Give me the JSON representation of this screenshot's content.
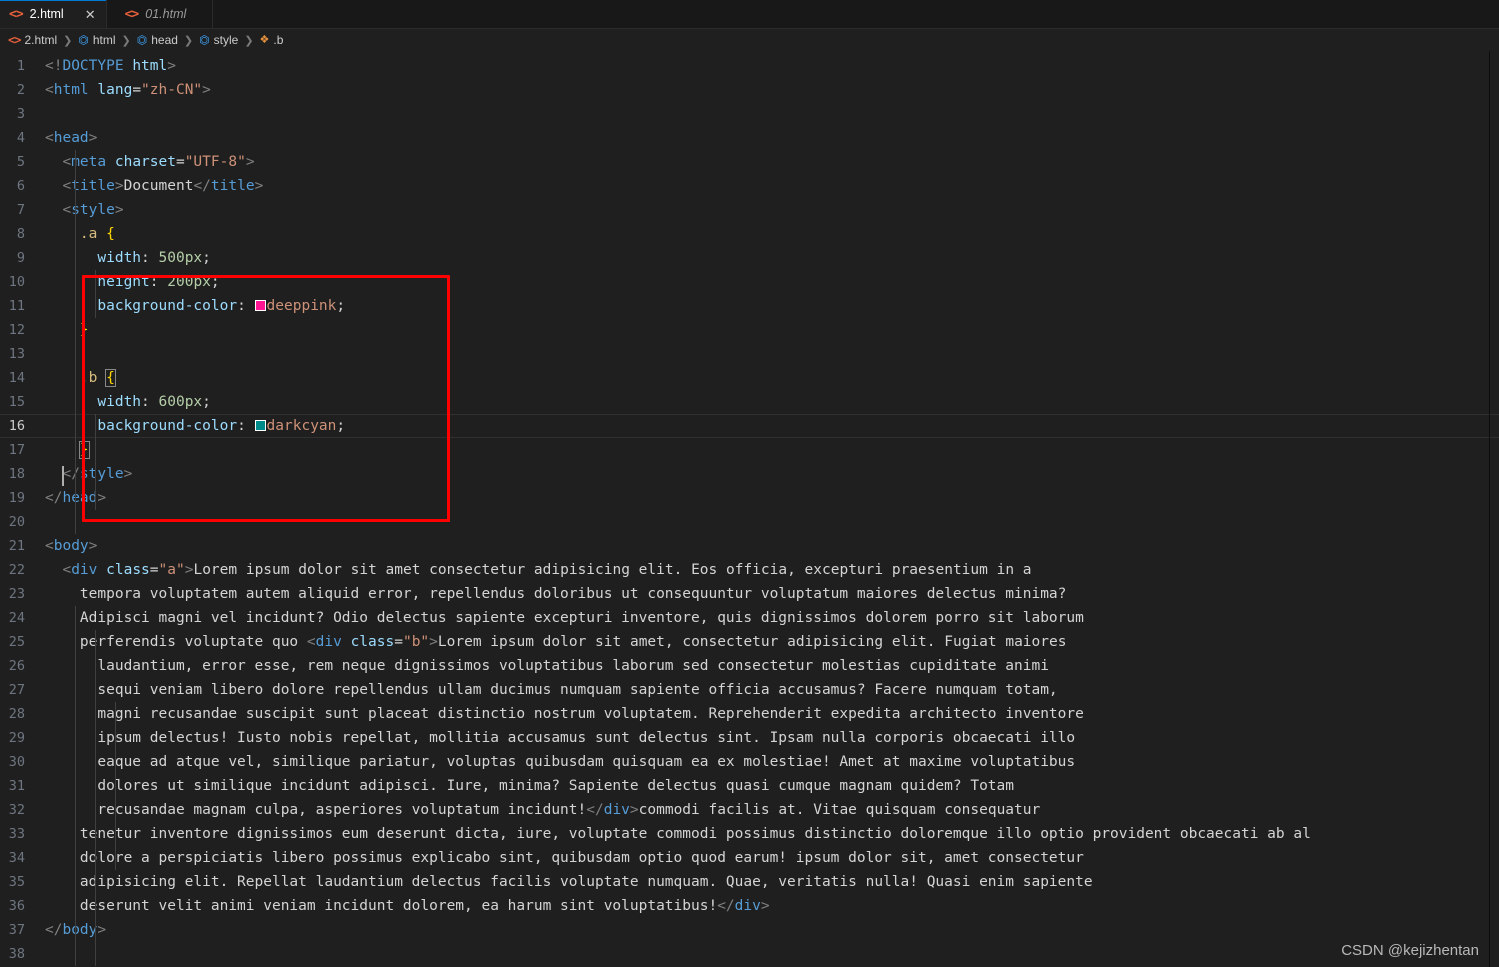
{
  "tabs": [
    {
      "label": "2.html",
      "icon": "html-icon",
      "active": true,
      "close": "✕"
    },
    {
      "label": "01.html",
      "icon": "html-icon",
      "active": false,
      "close": ""
    }
  ],
  "breadcrumb": {
    "items": [
      {
        "label": "2.html",
        "icon": "html-file-icon"
      },
      {
        "label": "html",
        "icon": "cube-icon"
      },
      {
        "label": "head",
        "icon": "cube-icon"
      },
      {
        "label": "style",
        "icon": "cube-icon"
      },
      {
        "label": ".b",
        "icon": "css-selector-icon"
      }
    ],
    "separator": "❯"
  },
  "editor": {
    "language": "html",
    "active_line": 16,
    "first_line": 1,
    "last_line": 38,
    "colors": {
      "deeppink": "#FF1493",
      "darkcyan": "#008B8B",
      "annotation_rect": "#FF0000",
      "editor_background": "#1f1f1f",
      "tabbar_background": "#181818",
      "accent": "#0078d4"
    },
    "lines": [
      {
        "n": 1,
        "tokens": [
          {
            "c": "t-bracket",
            "t": "<!"
          },
          {
            "c": "t-tag",
            "t": "DOCTYPE"
          },
          {
            "c": "t-text",
            "t": " "
          },
          {
            "c": "t-attr",
            "t": "html"
          },
          {
            "c": "t-bracket",
            "t": ">"
          }
        ]
      },
      {
        "n": 2,
        "tokens": [
          {
            "c": "t-bracket",
            "t": "<"
          },
          {
            "c": "t-tag",
            "t": "html"
          },
          {
            "c": "t-text",
            "t": " "
          },
          {
            "c": "t-attr",
            "t": "lang"
          },
          {
            "c": "t-punc",
            "t": "="
          },
          {
            "c": "t-str",
            "t": "\"zh-CN\""
          },
          {
            "c": "t-bracket",
            "t": ">"
          }
        ]
      },
      {
        "n": 3,
        "tokens": []
      },
      {
        "n": 4,
        "tokens": [
          {
            "c": "t-bracket",
            "t": "<"
          },
          {
            "c": "t-tag",
            "t": "head"
          },
          {
            "c": "t-bracket",
            "t": ">"
          }
        ]
      },
      {
        "n": 5,
        "tokens": [
          {
            "c": "t-text",
            "t": "  "
          },
          {
            "c": "t-bracket",
            "t": "<"
          },
          {
            "c": "t-tag",
            "t": "meta"
          },
          {
            "c": "t-text",
            "t": " "
          },
          {
            "c": "t-attr",
            "t": "charset"
          },
          {
            "c": "t-punc",
            "t": "="
          },
          {
            "c": "t-str",
            "t": "\"UTF-8\""
          },
          {
            "c": "t-bracket",
            "t": ">"
          }
        ]
      },
      {
        "n": 6,
        "tokens": [
          {
            "c": "t-text",
            "t": "  "
          },
          {
            "c": "t-bracket",
            "t": "<"
          },
          {
            "c": "t-tag",
            "t": "title"
          },
          {
            "c": "t-bracket",
            "t": ">"
          },
          {
            "c": "t-text",
            "t": "Document"
          },
          {
            "c": "t-bracket",
            "t": "</"
          },
          {
            "c": "t-tag",
            "t": "title"
          },
          {
            "c": "t-bracket",
            "t": ">"
          }
        ]
      },
      {
        "n": 7,
        "tokens": [
          {
            "c": "t-text",
            "t": "  "
          },
          {
            "c": "t-bracket",
            "t": "<"
          },
          {
            "c": "t-tag",
            "t": "style"
          },
          {
            "c": "t-bracket",
            "t": ">"
          }
        ]
      },
      {
        "n": 8,
        "tokens": [
          {
            "c": "t-text",
            "t": "    "
          },
          {
            "c": "t-sel",
            "t": ".a"
          },
          {
            "c": "t-text",
            "t": " "
          },
          {
            "c": "t-brace",
            "t": "{"
          }
        ]
      },
      {
        "n": 9,
        "tokens": [
          {
            "c": "t-text",
            "t": "      "
          },
          {
            "c": "t-prop",
            "t": "width"
          },
          {
            "c": "t-punc",
            "t": ": "
          },
          {
            "c": "t-num",
            "t": "500px"
          },
          {
            "c": "t-punc",
            "t": ";"
          }
        ]
      },
      {
        "n": 10,
        "tokens": [
          {
            "c": "t-text",
            "t": "      "
          },
          {
            "c": "t-prop",
            "t": "height"
          },
          {
            "c": "t-punc",
            "t": ": "
          },
          {
            "c": "t-num",
            "t": "200px"
          },
          {
            "c": "t-punc",
            "t": ";"
          }
        ]
      },
      {
        "n": 11,
        "tokens": [
          {
            "c": "t-text",
            "t": "      "
          },
          {
            "c": "t-prop",
            "t": "background-color"
          },
          {
            "c": "t-punc",
            "t": ": "
          },
          {
            "c": "swatch",
            "t": "#FF1493"
          },
          {
            "c": "t-val",
            "t": "deeppink"
          },
          {
            "c": "t-punc",
            "t": ";"
          }
        ]
      },
      {
        "n": 12,
        "tokens": [
          {
            "c": "t-text",
            "t": "    "
          },
          {
            "c": "t-brace",
            "t": "}"
          }
        ]
      },
      {
        "n": 13,
        "tokens": []
      },
      {
        "n": 14,
        "tokens": [
          {
            "c": "t-text",
            "t": "    "
          },
          {
            "c": "t-sel",
            "t": ".b"
          },
          {
            "c": "t-text",
            "t": " "
          },
          {
            "c": "t-brace bracematch",
            "t": "{"
          }
        ]
      },
      {
        "n": 15,
        "tokens": [
          {
            "c": "t-text",
            "t": "      "
          },
          {
            "c": "t-prop",
            "t": "width"
          },
          {
            "c": "t-punc",
            "t": ": "
          },
          {
            "c": "t-num",
            "t": "600px"
          },
          {
            "c": "t-punc",
            "t": ";"
          }
        ]
      },
      {
        "n": 16,
        "tokens": [
          {
            "c": "t-text",
            "t": "      "
          },
          {
            "c": "t-prop",
            "t": "background-color"
          },
          {
            "c": "t-punc",
            "t": ": "
          },
          {
            "c": "swatch",
            "t": "#008B8B"
          },
          {
            "c": "t-val",
            "t": "darkcyan"
          },
          {
            "c": "t-punc",
            "t": ";"
          }
        ]
      },
      {
        "n": 17,
        "tokens": [
          {
            "c": "t-text",
            "t": "    "
          },
          {
            "c": "t-brace bracematch",
            "t": "}"
          }
        ]
      },
      {
        "n": 18,
        "tokens": [
          {
            "c": "t-text",
            "t": "  "
          },
          {
            "c": "t-bracket",
            "t": "</"
          },
          {
            "c": "t-tag",
            "t": "style"
          },
          {
            "c": "t-bracket",
            "t": ">"
          }
        ]
      },
      {
        "n": 19,
        "tokens": [
          {
            "c": "t-bracket",
            "t": "</"
          },
          {
            "c": "t-tag",
            "t": "head"
          },
          {
            "c": "t-bracket",
            "t": ">"
          }
        ]
      },
      {
        "n": 20,
        "tokens": []
      },
      {
        "n": 21,
        "tokens": [
          {
            "c": "t-bracket",
            "t": "<"
          },
          {
            "c": "t-tag",
            "t": "body"
          },
          {
            "c": "t-bracket",
            "t": ">"
          }
        ]
      },
      {
        "n": 22,
        "tokens": [
          {
            "c": "t-text",
            "t": "  "
          },
          {
            "c": "t-bracket",
            "t": "<"
          },
          {
            "c": "t-tag",
            "t": "div"
          },
          {
            "c": "t-text",
            "t": " "
          },
          {
            "c": "t-attr",
            "t": "class"
          },
          {
            "c": "t-punc",
            "t": "="
          },
          {
            "c": "t-str",
            "t": "\"a\""
          },
          {
            "c": "t-bracket",
            "t": ">"
          },
          {
            "c": "t-text",
            "t": "Lorem ipsum dolor sit amet consectetur adipisicing elit. Eos officia, excepturi praesentium in a"
          }
        ]
      },
      {
        "n": 23,
        "tokens": [
          {
            "c": "t-text",
            "t": "    tempora voluptatem autem aliquid error, repellendus doloribus ut consequuntur voluptatum maiores delectus minima?"
          }
        ]
      },
      {
        "n": 24,
        "tokens": [
          {
            "c": "t-text",
            "t": "    Adipisci magni vel incidunt? Odio delectus sapiente excepturi inventore, quis dignissimos dolorem porro sit laborum"
          }
        ]
      },
      {
        "n": 25,
        "tokens": [
          {
            "c": "t-text",
            "t": "    perferendis voluptate quo "
          },
          {
            "c": "t-bracket",
            "t": "<"
          },
          {
            "c": "t-tag",
            "t": "div"
          },
          {
            "c": "t-text",
            "t": " "
          },
          {
            "c": "t-attr",
            "t": "class"
          },
          {
            "c": "t-punc",
            "t": "="
          },
          {
            "c": "t-str",
            "t": "\"b\""
          },
          {
            "c": "t-bracket",
            "t": ">"
          },
          {
            "c": "t-text",
            "t": "Lorem ipsum dolor sit amet, consectetur adipisicing elit. Fugiat maiores"
          }
        ]
      },
      {
        "n": 26,
        "tokens": [
          {
            "c": "t-text",
            "t": "      laudantium, error esse, rem neque dignissimos voluptatibus laborum sed consectetur molestias cupiditate animi"
          }
        ]
      },
      {
        "n": 27,
        "tokens": [
          {
            "c": "t-text",
            "t": "      sequi veniam libero dolore repellendus ullam ducimus numquam sapiente officia accusamus? Facere numquam totam,"
          }
        ]
      },
      {
        "n": 28,
        "tokens": [
          {
            "c": "t-text",
            "t": "      magni recusandae suscipit sunt placeat distinctio nostrum voluptatem. Reprehenderit expedita architecto inventore"
          }
        ]
      },
      {
        "n": 29,
        "tokens": [
          {
            "c": "t-text",
            "t": "      ipsum delectus! Iusto nobis repellat, mollitia accusamus sunt delectus sint. Ipsam nulla corporis obcaecati illo"
          }
        ]
      },
      {
        "n": 30,
        "tokens": [
          {
            "c": "t-text",
            "t": "      eaque ad atque vel, similique pariatur, voluptas quibusdam quisquam ea ex molestiae! Amet at maxime voluptatibus"
          }
        ]
      },
      {
        "n": 31,
        "tokens": [
          {
            "c": "t-text",
            "t": "      dolores ut similique incidunt adipisci. Iure, minima? Sapiente delectus quasi cumque magnam quidem? Totam"
          }
        ]
      },
      {
        "n": 32,
        "tokens": [
          {
            "c": "t-text",
            "t": "      recusandae magnam culpa, asperiores voluptatum incidunt!"
          },
          {
            "c": "t-bracket",
            "t": "</"
          },
          {
            "c": "t-tag",
            "t": "div"
          },
          {
            "c": "t-bracket",
            "t": ">"
          },
          {
            "c": "t-text",
            "t": "commodi facilis at. Vitae quisquam consequatur"
          }
        ]
      },
      {
        "n": 33,
        "tokens": [
          {
            "c": "t-text",
            "t": "    tenetur inventore dignissimos eum deserunt dicta, iure, voluptate commodi possimus distinctio doloremque illo optio provident obcaecati ab al"
          }
        ]
      },
      {
        "n": 34,
        "tokens": [
          {
            "c": "t-text",
            "t": "    dolore a perspiciatis libero possimus explicabo sint, quibusdam optio quod earum! ipsum dolor sit, amet consectetur"
          }
        ]
      },
      {
        "n": 35,
        "tokens": [
          {
            "c": "t-text",
            "t": "    adipisicing elit. Repellat laudantium delectus facilis voluptate numquam. Quae, veritatis nulla! Quasi enim sapiente"
          }
        ]
      },
      {
        "n": 36,
        "tokens": [
          {
            "c": "t-text",
            "t": "    deserunt velit animi veniam incidunt dolorem, ea harum sint voluptatibus!"
          },
          {
            "c": "t-bracket",
            "t": "</"
          },
          {
            "c": "t-tag",
            "t": "div"
          },
          {
            "c": "t-bracket",
            "t": ">"
          }
        ]
      },
      {
        "n": 37,
        "tokens": [
          {
            "c": "t-bracket",
            "t": "</"
          },
          {
            "c": "t-tag",
            "t": "body"
          },
          {
            "c": "t-bracket",
            "t": ">"
          }
        ]
      },
      {
        "n": 38,
        "tokens": []
      }
    ]
  },
  "watermark": {
    "text": "CSDN @kejizhentan"
  }
}
